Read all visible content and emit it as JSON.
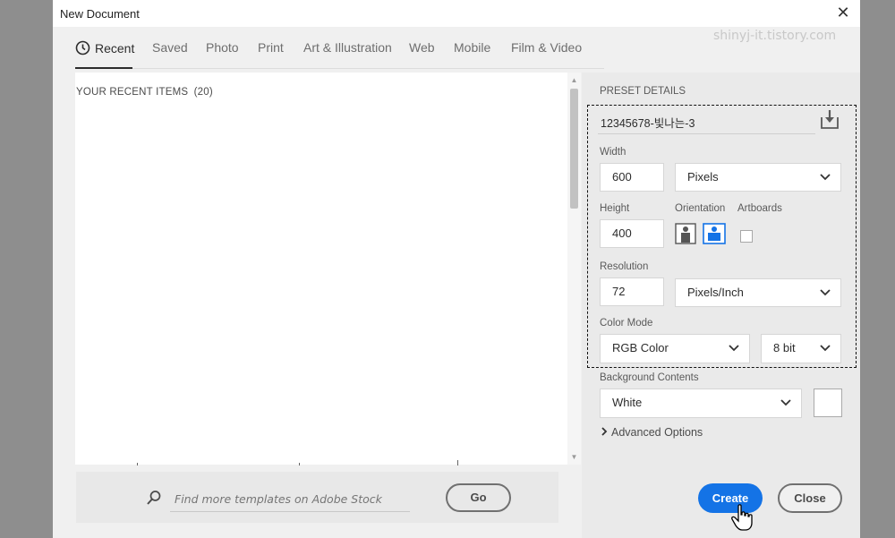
{
  "window": {
    "title": "New Document"
  },
  "watermark": "shinyj-it.tistory.com",
  "tabs": [
    {
      "label": "Recent",
      "active": true
    },
    {
      "label": "Saved"
    },
    {
      "label": "Photo"
    },
    {
      "label": "Print"
    },
    {
      "label": "Art & Illustration"
    },
    {
      "label": "Web"
    },
    {
      "label": "Mobile"
    },
    {
      "label": "Film & Video"
    }
  ],
  "recent": {
    "heading": "YOUR RECENT ITEMS",
    "count": "(20)"
  },
  "search": {
    "placeholder": "Find more templates on Adobe Stock",
    "go_label": "Go"
  },
  "preset": {
    "heading": "PRESET DETAILS",
    "name": "12345678-빛나는-3",
    "width_label": "Width",
    "width_value": "600",
    "width_unit": "Pixels",
    "height_label": "Height",
    "height_value": "400",
    "orientation_label": "Orientation",
    "orientation_selected": "landscape",
    "artboards_label": "Artboards",
    "artboards_checked": false,
    "resolution_label": "Resolution",
    "resolution_value": "72",
    "resolution_unit": "Pixels/Inch",
    "color_mode_label": "Color Mode",
    "color_mode": "RGB Color",
    "bit_depth": "8 bit",
    "bg_label": "Background Contents",
    "bg_value": "White",
    "bg_color": "#ffffff",
    "advanced_label": "Advanced Options"
  },
  "actions": {
    "create_label": "Create",
    "close_label": "Close"
  },
  "colors": {
    "accent": "#1473e6"
  }
}
